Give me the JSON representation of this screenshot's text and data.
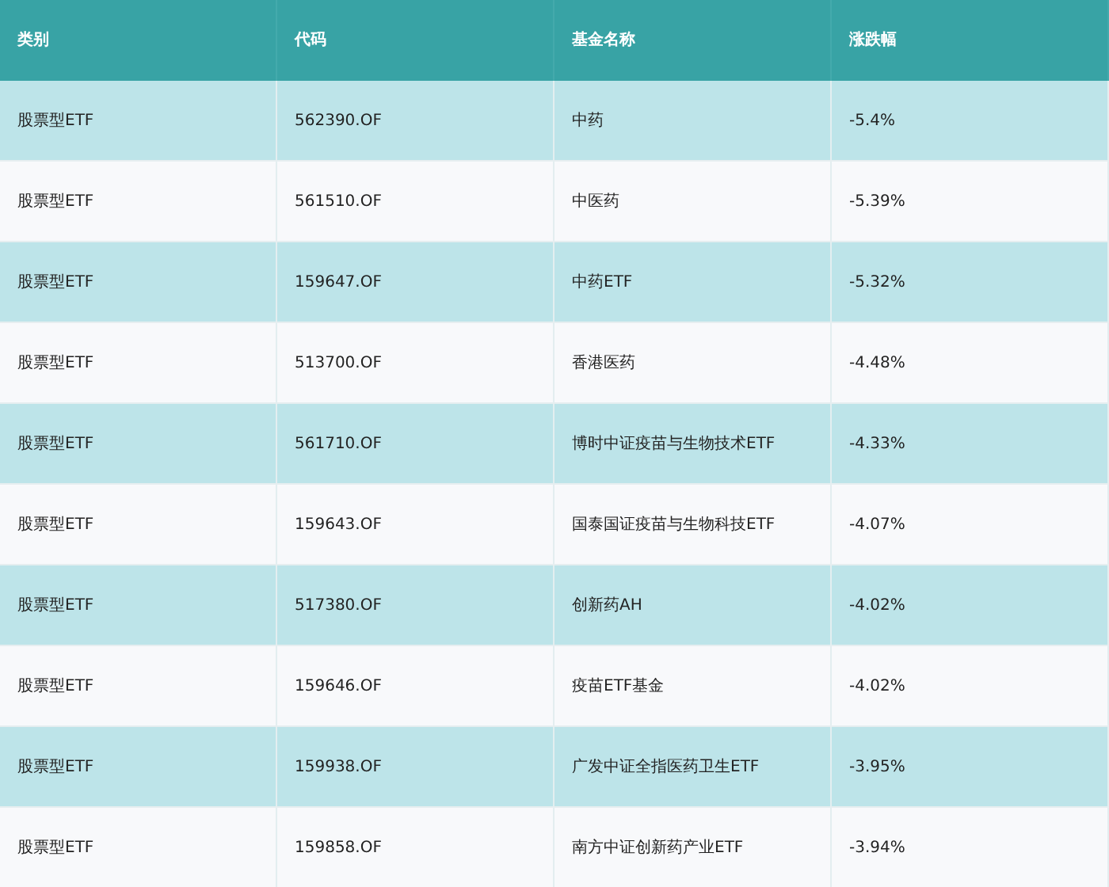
{
  "table": {
    "columns": [
      "类别",
      "代码",
      "基金名称",
      "涨跌幅"
    ],
    "rows": [
      [
        "股票型ETF",
        "562390.OF",
        "中药",
        "-5.4%"
      ],
      [
        "股票型ETF",
        "561510.OF",
        "中医药",
        "-5.39%"
      ],
      [
        "股票型ETF",
        "159647.OF",
        "中药ETF",
        "-5.32%"
      ],
      [
        "股票型ETF",
        "513700.OF",
        "香港医药",
        "-4.48%"
      ],
      [
        "股票型ETF",
        "561710.OF",
        "博时中证疫苗与生物技术ETF",
        "-4.33%"
      ],
      [
        "股票型ETF",
        "159643.OF",
        "国泰国证疫苗与生物科技ETF",
        "-4.07%"
      ],
      [
        "股票型ETF",
        "517380.OF",
        "创新药AH",
        "-4.02%"
      ],
      [
        "股票型ETF",
        "159646.OF",
        "疫苗ETF基金",
        "-4.02%"
      ],
      [
        "股票型ETF",
        "159938.OF",
        "广发中证全指医药卫生ETF",
        "-3.95%"
      ],
      [
        "股票型ETF",
        "159858.OF",
        "南方中证创新药产业ETF",
        "-3.94%"
      ]
    ]
  }
}
